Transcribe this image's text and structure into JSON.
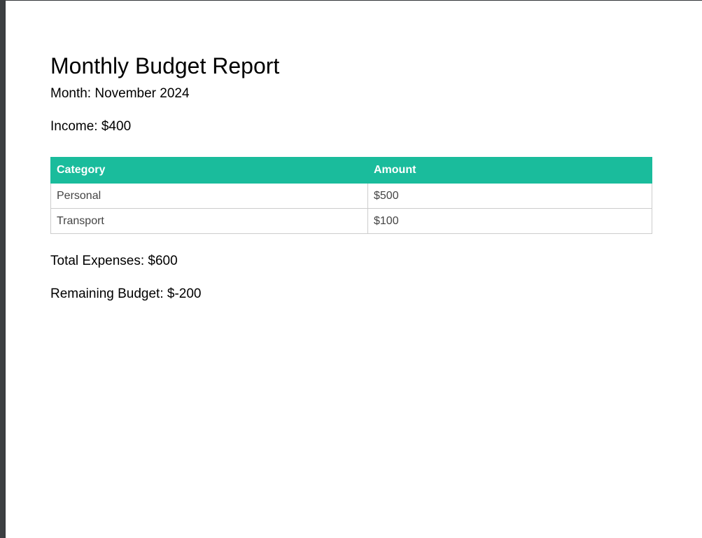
{
  "report": {
    "title": "Monthly Budget Report",
    "month": "Month: November 2024",
    "income": "Income: $400",
    "table": {
      "headers": [
        "Category",
        "Amount"
      ],
      "rows": [
        [
          "Personal",
          "$500"
        ],
        [
          "Transport",
          "$100"
        ]
      ]
    },
    "total_expenses": "Total Expenses: $600",
    "remaining_budget": "Remaining Budget: $-200"
  },
  "colors": {
    "header_bg": "#1abc9c",
    "header_text": "#ffffff",
    "cell_text": "#444444",
    "border": "#cccccc"
  }
}
